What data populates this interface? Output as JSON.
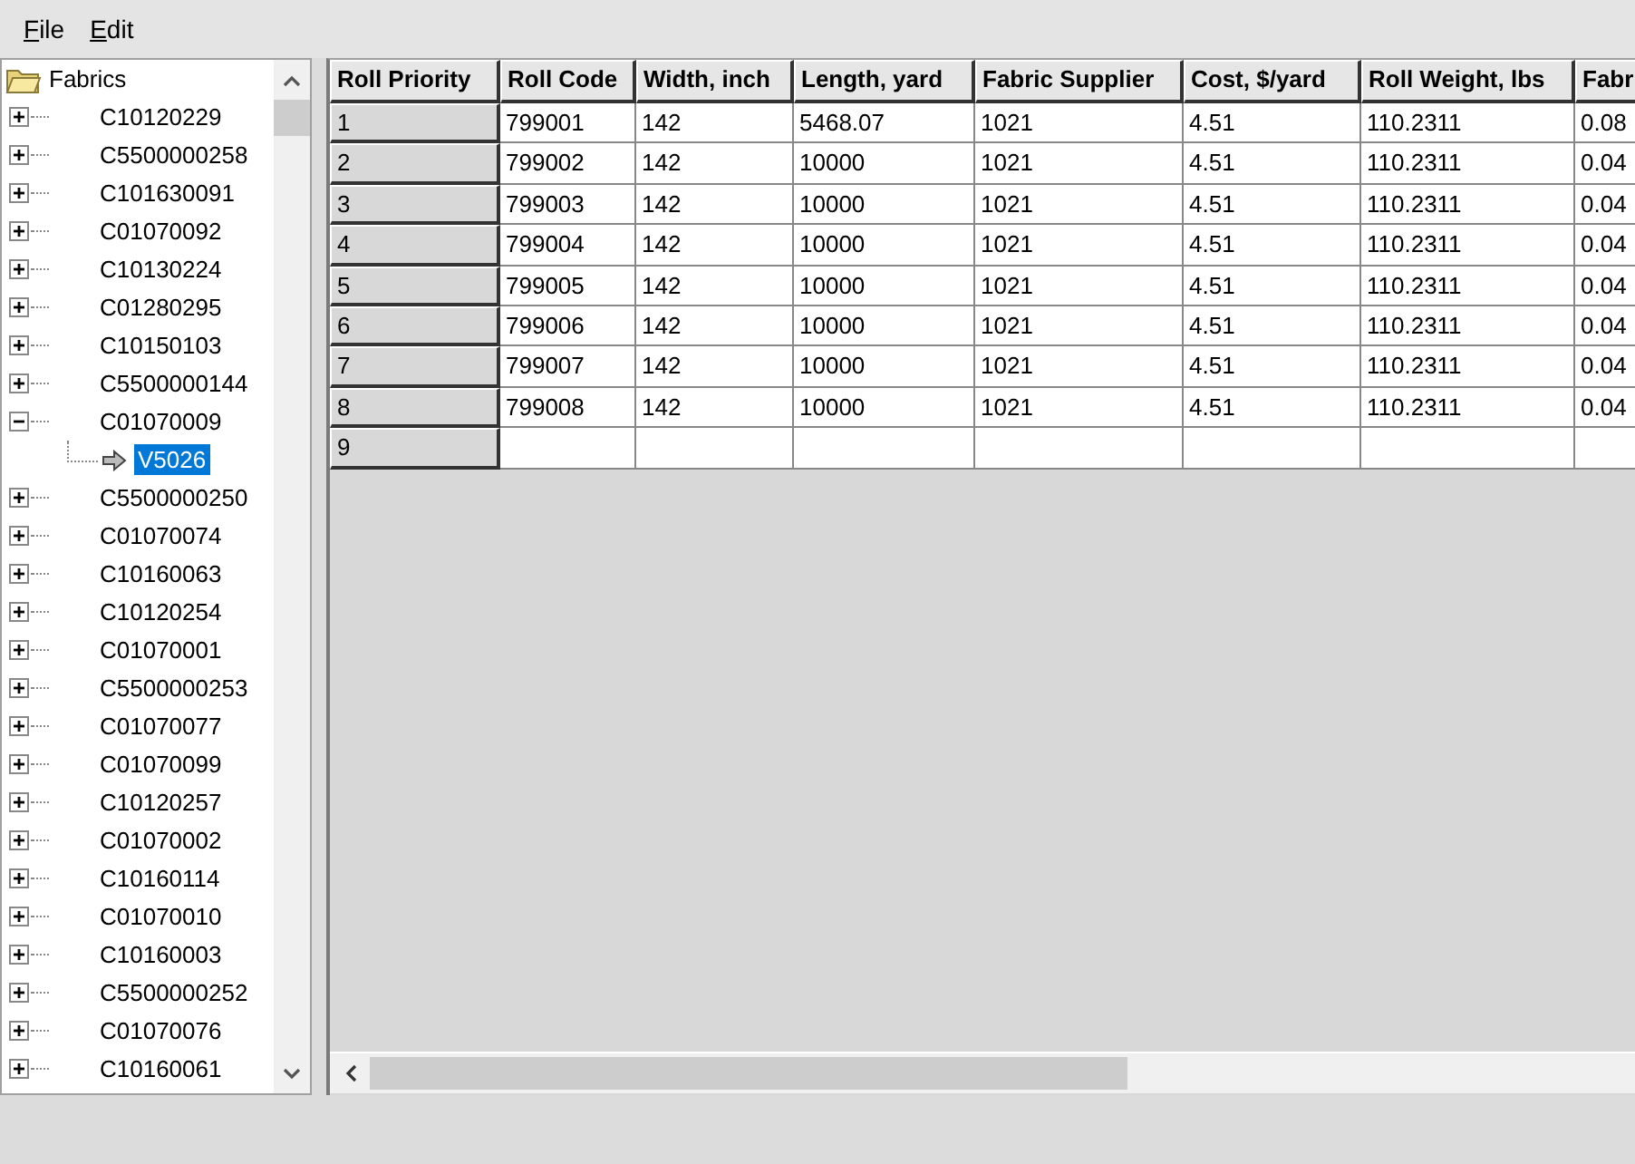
{
  "menu": [
    {
      "label": "File"
    },
    {
      "label": "Edit"
    }
  ],
  "tree": {
    "label": "Fabrics",
    "expanded": true,
    "selected": false,
    "children": [
      {
        "label": "C10120229",
        "expanded": false,
        "selected": false
      },
      {
        "label": "C5500000258",
        "expanded": false,
        "selected": false
      },
      {
        "label": "C101630091",
        "expanded": false,
        "selected": false
      },
      {
        "label": "C01070092",
        "expanded": false,
        "selected": false
      },
      {
        "label": "C10130224",
        "expanded": false,
        "selected": false
      },
      {
        "label": "C01280295",
        "expanded": false,
        "selected": false
      },
      {
        "label": "C10150103",
        "expanded": false,
        "selected": false
      },
      {
        "label": "C5500000144",
        "expanded": false,
        "selected": false
      },
      {
        "label": "C01070009",
        "expanded": true,
        "selected": false,
        "children": [
          {
            "label": "V5026",
            "selected": true
          }
        ]
      },
      {
        "label": "C5500000250",
        "expanded": false,
        "selected": false
      },
      {
        "label": "C01070074",
        "expanded": false,
        "selected": false
      },
      {
        "label": "C10160063",
        "expanded": false,
        "selected": false
      },
      {
        "label": "C10120254",
        "expanded": false,
        "selected": false
      },
      {
        "label": "C01070001",
        "expanded": false,
        "selected": false
      },
      {
        "label": "C5500000253",
        "expanded": false,
        "selected": false
      },
      {
        "label": "C01070077",
        "expanded": false,
        "selected": false
      },
      {
        "label": "C01070099",
        "expanded": false,
        "selected": false
      },
      {
        "label": "C10120257",
        "expanded": false,
        "selected": false
      },
      {
        "label": "C01070002",
        "expanded": false,
        "selected": false
      },
      {
        "label": "C10160114",
        "expanded": false,
        "selected": false
      },
      {
        "label": "C01070010",
        "expanded": false,
        "selected": false
      },
      {
        "label": "C10160003",
        "expanded": false,
        "selected": false
      },
      {
        "label": "C5500000252",
        "expanded": false,
        "selected": false
      },
      {
        "label": "C01070076",
        "expanded": false,
        "selected": false
      },
      {
        "label": "C10160061",
        "expanded": false,
        "selected": false
      }
    ]
  },
  "table": {
    "columns": [
      "Roll Priority",
      "Roll Code",
      "Width, inch",
      "Length, yard",
      "Fabric Supplier",
      "Cost, $/yard",
      "Roll Weight, lbs",
      "Fabr"
    ],
    "rows": [
      {
        "cells": [
          "1",
          "799001",
          "142",
          "5468.07",
          "1021",
          "4.51",
          "110.2311",
          "0.08"
        ]
      },
      {
        "cells": [
          "2",
          "799002",
          "142",
          "10000",
          "1021",
          "4.51",
          "110.2311",
          "0.04"
        ]
      },
      {
        "cells": [
          "3",
          "799003",
          "142",
          "10000",
          "1021",
          "4.51",
          "110.2311",
          "0.04"
        ]
      },
      {
        "cells": [
          "4",
          "799004",
          "142",
          "10000",
          "1021",
          "4.51",
          "110.2311",
          "0.04"
        ]
      },
      {
        "cells": [
          "5",
          "799005",
          "142",
          "10000",
          "1021",
          "4.51",
          "110.2311",
          "0.04"
        ]
      },
      {
        "cells": [
          "6",
          "799006",
          "142",
          "10000",
          "1021",
          "4.51",
          "110.2311",
          "0.04"
        ]
      },
      {
        "cells": [
          "7",
          "799007",
          "142",
          "10000",
          "1021",
          "4.51",
          "110.2311",
          "0.04"
        ]
      },
      {
        "cells": [
          "8",
          "799008",
          "142",
          "10000",
          "1021",
          "4.51",
          "110.2311",
          "0.04"
        ]
      },
      {
        "cells": [
          "9"
        ]
      }
    ]
  }
}
